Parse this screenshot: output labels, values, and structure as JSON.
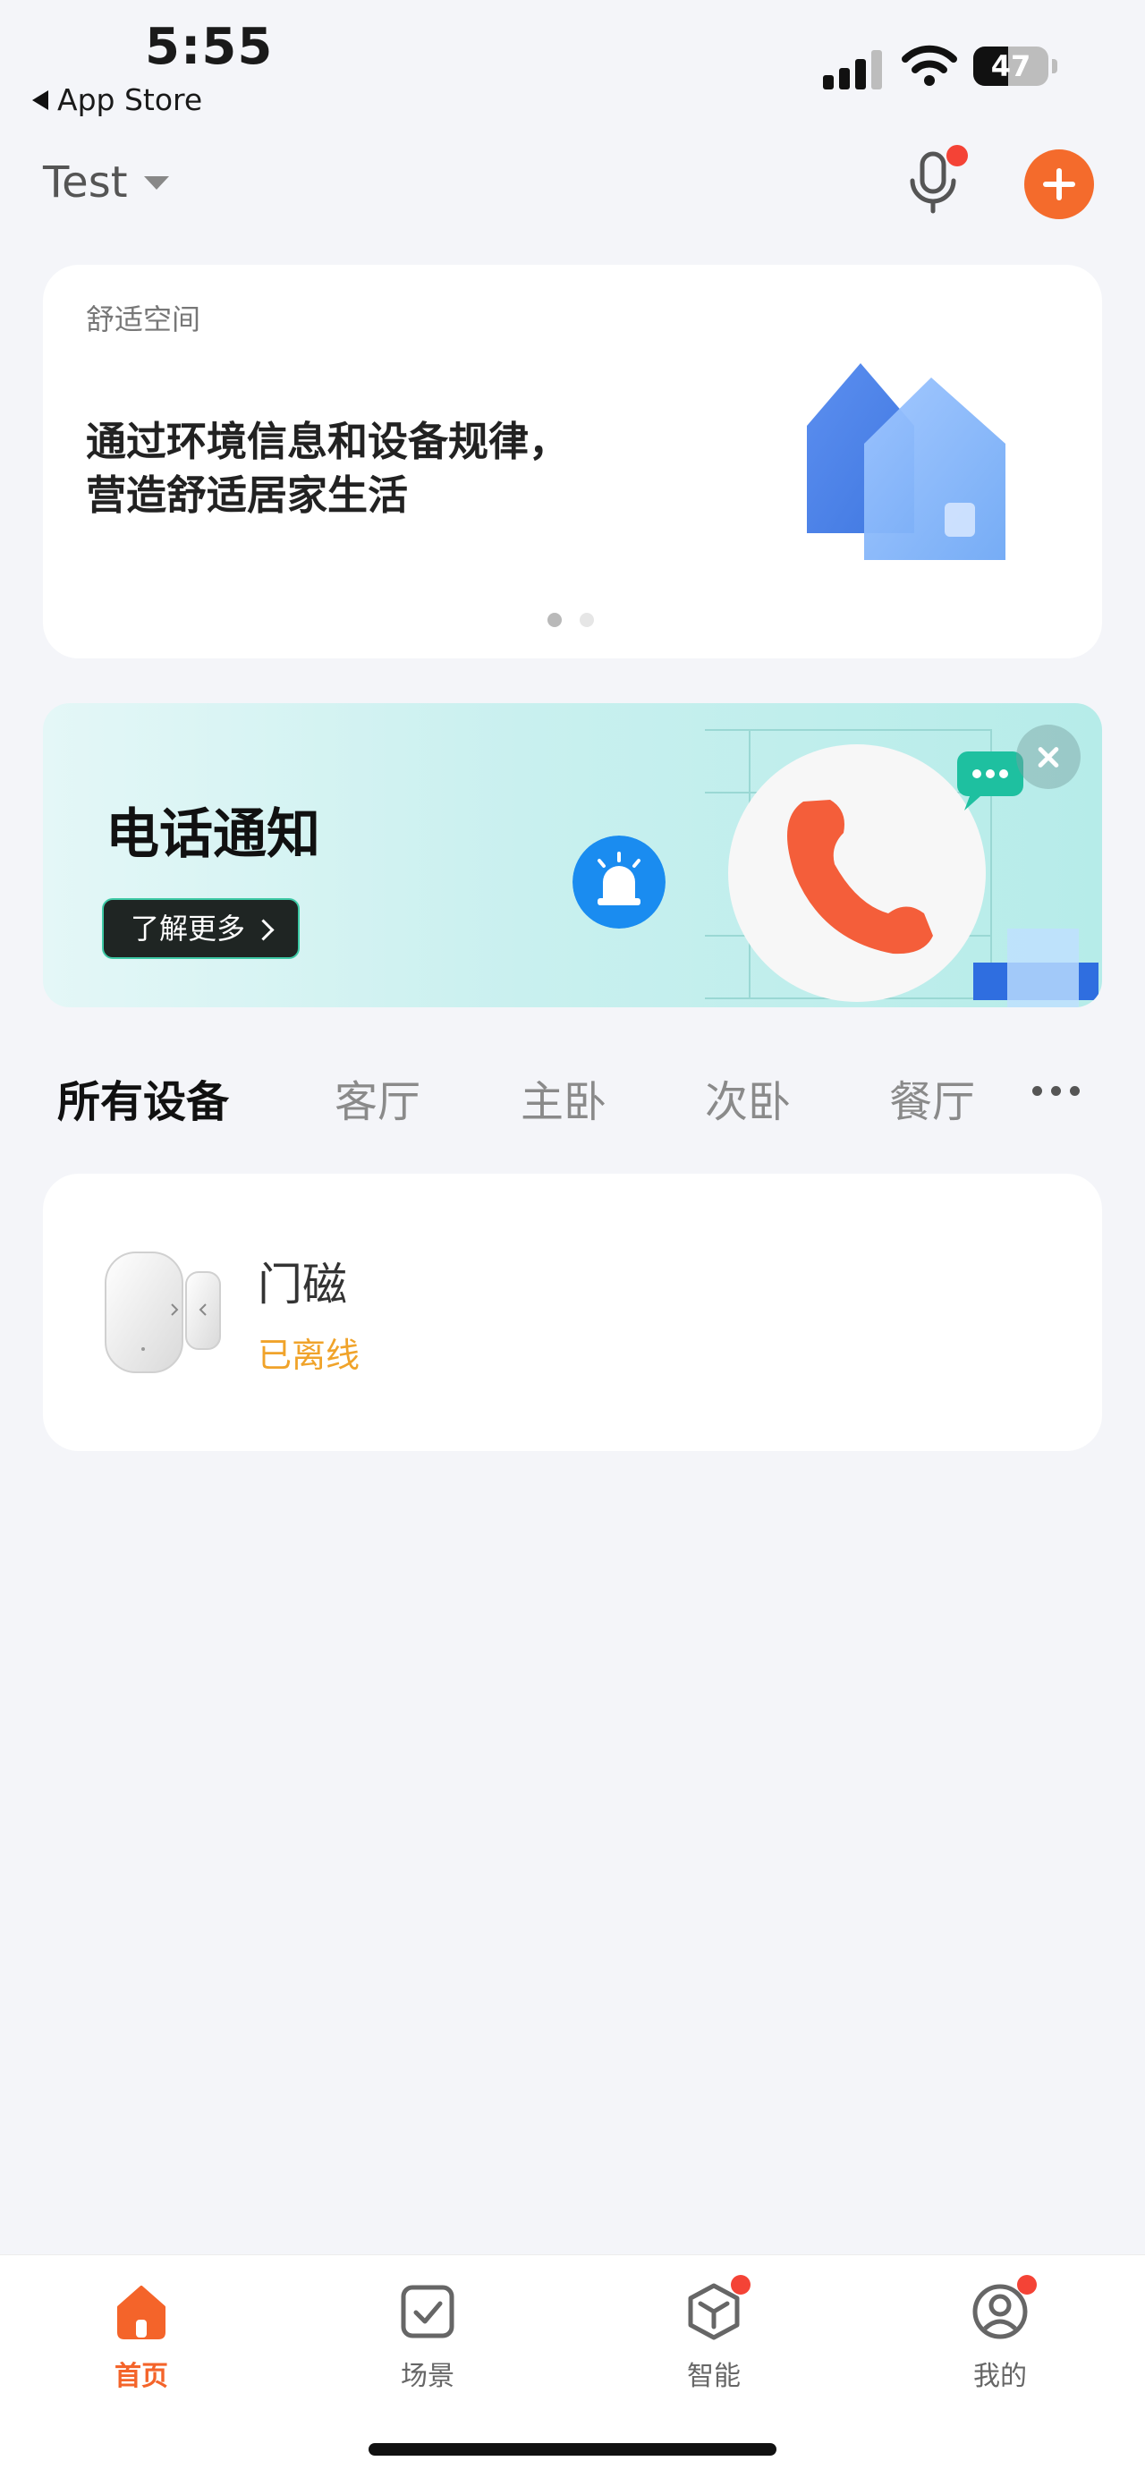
{
  "status_bar": {
    "time": "5:55",
    "back_app": "App Store",
    "battery": "47",
    "battery_level": 0.47
  },
  "header": {
    "home_name": "Test",
    "mic_icon": "microphone-icon",
    "add_icon": "plus-icon"
  },
  "comfort_card": {
    "label": "舒适空间",
    "text": "通过环境信息和设备规律，营造舒适居家生活",
    "page_count": 2,
    "active_page": 1
  },
  "phone_banner": {
    "title": "电话通知",
    "button_label": "了解更多"
  },
  "room_tabs": [
    {
      "label": "所有设备",
      "active": true
    },
    {
      "label": "客厅",
      "active": false
    },
    {
      "label": "主卧",
      "active": false
    },
    {
      "label": "次卧",
      "active": false
    },
    {
      "label": "餐厅",
      "active": false
    }
  ],
  "devices": [
    {
      "name": "门磁",
      "status": "已离线"
    }
  ],
  "bottom_nav": [
    {
      "label": "首页",
      "icon": "home-icon",
      "active": true,
      "badge": false
    },
    {
      "label": "场景",
      "icon": "scene-checkbox-icon",
      "active": false,
      "badge": false
    },
    {
      "label": "智能",
      "icon": "smart-cube-icon",
      "active": false,
      "badge": true
    },
    {
      "label": "我的",
      "icon": "profile-icon",
      "active": false,
      "badge": true
    }
  ],
  "colors": {
    "accent": "#f46b2c",
    "offline": "#f0a32a",
    "badge": "#f44336",
    "background": "#f4f5f9"
  }
}
